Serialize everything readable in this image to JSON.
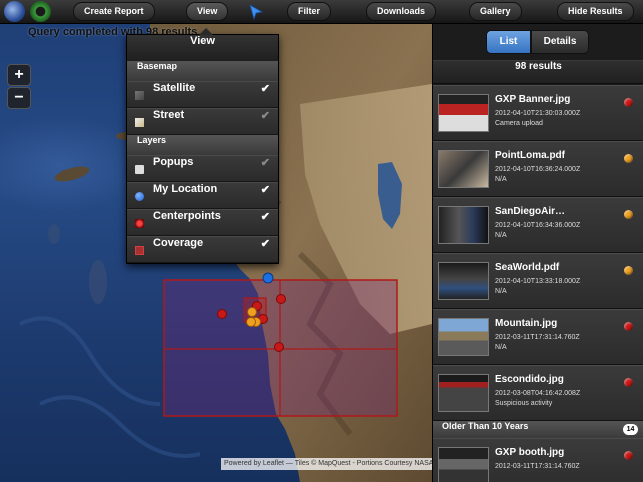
{
  "toolbar": {
    "buttons": [
      {
        "label": "Create Report"
      },
      {
        "label": "View"
      },
      {
        "label": "Filter"
      },
      {
        "label": "Downloads"
      },
      {
        "label": "Gallery"
      },
      {
        "label": "Hide Results"
      }
    ],
    "left_icons": [
      "globe-icon",
      "settings-gear-icon"
    ],
    "location_icon": "location-arrow-icon"
  },
  "status": {
    "query_text": "Query completed with 98 results"
  },
  "map": {
    "zoom_in_label": "+",
    "zoom_out_label": "−",
    "attribution": "Powered by Leaflet — Tiles © MapQuest - Portions Courtesy NASA"
  },
  "view_menu": {
    "title": "View",
    "basemap_header": "Basemap",
    "basemap": [
      {
        "label": "Satellite",
        "icon": "satellite-icon",
        "checked": true
      },
      {
        "label": "Street",
        "icon": "street-map-icon",
        "checked": false
      }
    ],
    "layers_header": "Layers",
    "layers": [
      {
        "label": "Popups",
        "icon": "popup-icon",
        "checked": false
      },
      {
        "label": "My Location",
        "icon": "my-location-icon",
        "checked": true
      },
      {
        "label": "Centerpoints",
        "icon": "centerpoints-icon",
        "checked": true
      },
      {
        "label": "Coverage",
        "icon": "coverage-icon",
        "checked": true
      }
    ],
    "check_glyph": "✔"
  },
  "panel": {
    "tabs": {
      "list": "List",
      "details": "Details"
    },
    "results_count": "98 results",
    "results": [
      {
        "title": "GXP Banner.jpg",
        "timestamp": "2012-04-10T21:30:03.000Z",
        "description": "Camera upload",
        "status_color": "#c81818"
      },
      {
        "title": "PointLoma.pdf",
        "timestamp": "2012-04-10T16:36:24.000Z",
        "description": "N/A",
        "status_color": "#f0a020"
      },
      {
        "title": "SanDiegoAir…",
        "timestamp": "2012-04-10T16:34:36.000Z",
        "description": "N/A",
        "status_color": "#f0a020"
      },
      {
        "title": "SeaWorld.pdf",
        "timestamp": "2012-04-10T13:33:18.000Z",
        "description": "N/A",
        "status_color": "#f0a020"
      },
      {
        "title": "Mountain.jpg",
        "timestamp": "2012-03-11T17:31:14.760Z",
        "description": "N/A",
        "status_color": "#c81818"
      },
      {
        "title": "Escondido.jpg",
        "timestamp": "2012-03-08T04:16:42.008Z",
        "description": "Suspicious activity",
        "status_color": "#c81818"
      }
    ],
    "group": {
      "label": "Older Than 10 Years",
      "count": "14"
    },
    "older_results": [
      {
        "title": "GXP booth.jpg",
        "timestamp": "2012-03-11T17:31:14.760Z",
        "description": "",
        "status_color": "#c81818"
      }
    ]
  },
  "colors": {
    "accent_blue": "#3573c2",
    "marker_red": "#c81818",
    "marker_orange": "#f0a020",
    "coverage_red": "#b01818"
  }
}
